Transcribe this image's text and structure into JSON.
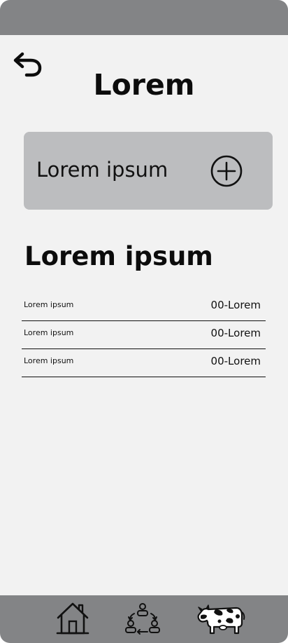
{
  "header": {
    "back_icon": "undo-arrow-icon",
    "title": "Lorem"
  },
  "add_card": {
    "label": "Lorem ipsum",
    "icon": "plus-circle-icon"
  },
  "section": {
    "title": "Lorem ipsum"
  },
  "rows": [
    {
      "label": "Lorem ipsum",
      "value": "00-Lorem"
    },
    {
      "label": "Lorem ipsum",
      "value": "00-Lorem"
    },
    {
      "label": "Lorem ipsum",
      "value": "00-Lorem"
    }
  ],
  "bottom_nav": {
    "items": [
      {
        "icon": "home-icon"
      },
      {
        "icon": "people-exchange-icon"
      },
      {
        "icon": "cow-icon"
      }
    ]
  },
  "colors": {
    "bars": "#838486",
    "background": "#f2f2f2",
    "card": "#bcbdbf",
    "text": "#0c0c0c"
  }
}
